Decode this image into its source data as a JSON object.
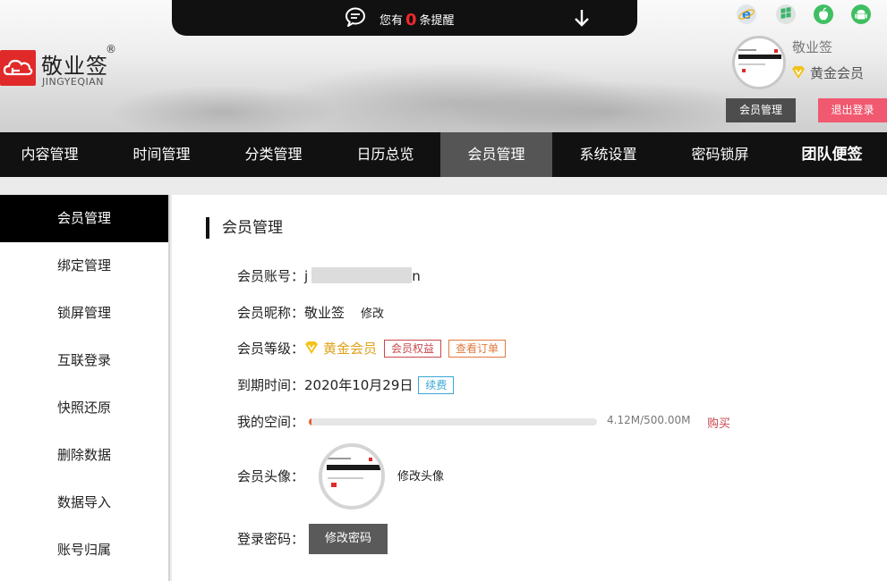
{
  "notice": {
    "prefix": "您有",
    "count": "0",
    "suffix": "条提醒"
  },
  "logo": {
    "name": "敬业签",
    "registered": "®",
    "sub": "JINGYEQIAN"
  },
  "platforms": [
    "ie-icon",
    "windows-icon",
    "apple-icon",
    "android-icon"
  ],
  "profile": {
    "name": "敬业签",
    "level": "黄金会员",
    "member_btn": "会员管理",
    "logout_btn": "退出登录"
  },
  "nav": {
    "items": [
      {
        "label": "内容管理",
        "active": false
      },
      {
        "label": "时间管理",
        "active": false
      },
      {
        "label": "分类管理",
        "active": false
      },
      {
        "label": "日历总览",
        "active": false
      },
      {
        "label": "会员管理",
        "active": true
      },
      {
        "label": "系统设置",
        "active": false
      },
      {
        "label": "密码锁屏",
        "active": false
      },
      {
        "label": "团队便签",
        "active": false
      }
    ]
  },
  "sidebar": {
    "items": [
      {
        "label": "会员管理",
        "active": true
      },
      {
        "label": "绑定管理",
        "active": false
      },
      {
        "label": "锁屏管理",
        "active": false
      },
      {
        "label": "互联登录",
        "active": false
      },
      {
        "label": "快照还原",
        "active": false
      },
      {
        "label": "删除数据",
        "active": false
      },
      {
        "label": "数据导入",
        "active": false
      },
      {
        "label": "账号归属",
        "active": false
      }
    ]
  },
  "main": {
    "title": "会员管理",
    "account_label": "会员账号：",
    "account_start": "j",
    "account_end": "n",
    "nickname_label": "会员昵称：",
    "nickname": "敬业签",
    "nickname_edit": "修改",
    "level_label": "会员等级：",
    "level": "黄金会员",
    "level_rights": "会员权益",
    "level_orders": "查看订单",
    "expire_label": "到期时间：",
    "expire_date": "2020年10月29日",
    "renew": "续费",
    "space_label": "我的空间：",
    "space_used": 4.12,
    "space_total": 500.0,
    "space_text": "4.12M/500.00M",
    "buy": "购买",
    "avatar_label": "会员头像：",
    "avatar_change": "修改头像",
    "password_label": "登录密码：",
    "password_btn": "修改密码"
  },
  "colors": {
    "accent_red": "#e02a2a",
    "logout_pink": "#f0596f",
    "gold": "#e0a21a",
    "renew_blue": "#3aa7d6"
  }
}
